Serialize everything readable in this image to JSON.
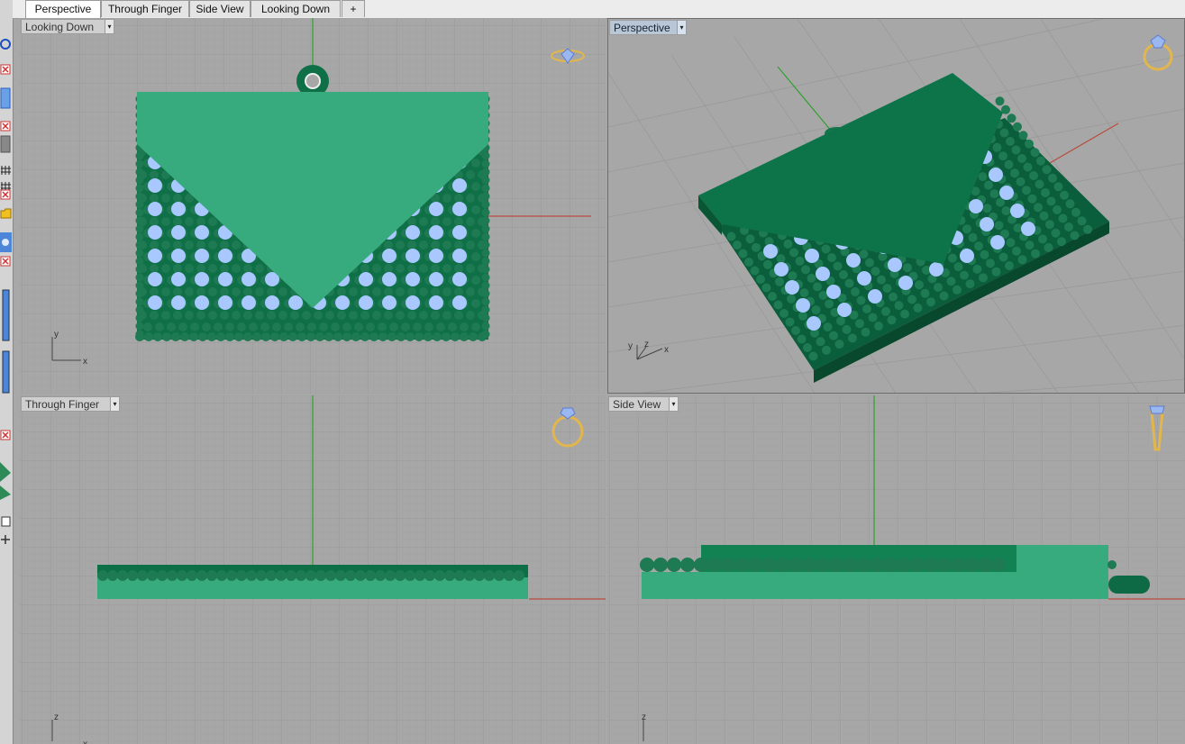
{
  "tabs": [
    {
      "label": "Perspective",
      "active": true
    },
    {
      "label": "Through Finger",
      "active": false
    },
    {
      "label": "Side View",
      "active": false
    },
    {
      "label": "Looking Down",
      "active": false
    }
  ],
  "add_tab_glyph": "+",
  "viewports": {
    "looking_down": {
      "label": "Looking Down",
      "axis_x": "x",
      "axis_y": "y"
    },
    "perspective": {
      "label": "Perspective",
      "axis_x": "x",
      "axis_y": "y",
      "axis_z": "z"
    },
    "through_finger": {
      "label": "Through Finger",
      "axis_z": "z",
      "axis_x": "x"
    },
    "side_view": {
      "label": "Side View",
      "axis_z": "z"
    }
  },
  "dropdown_glyph": "▾",
  "colors": {
    "viewport_bg": "#a7a7a7",
    "grid": "#9a9a9a",
    "model_face": "#35a87a",
    "model_dark": "#0b6b43",
    "bead": "#1e7a52",
    "gem": "#a8c8ff",
    "axis_x": "#b84b3c",
    "axis_y": "#2fa02f",
    "ring_icon": "#e2b64c"
  }
}
